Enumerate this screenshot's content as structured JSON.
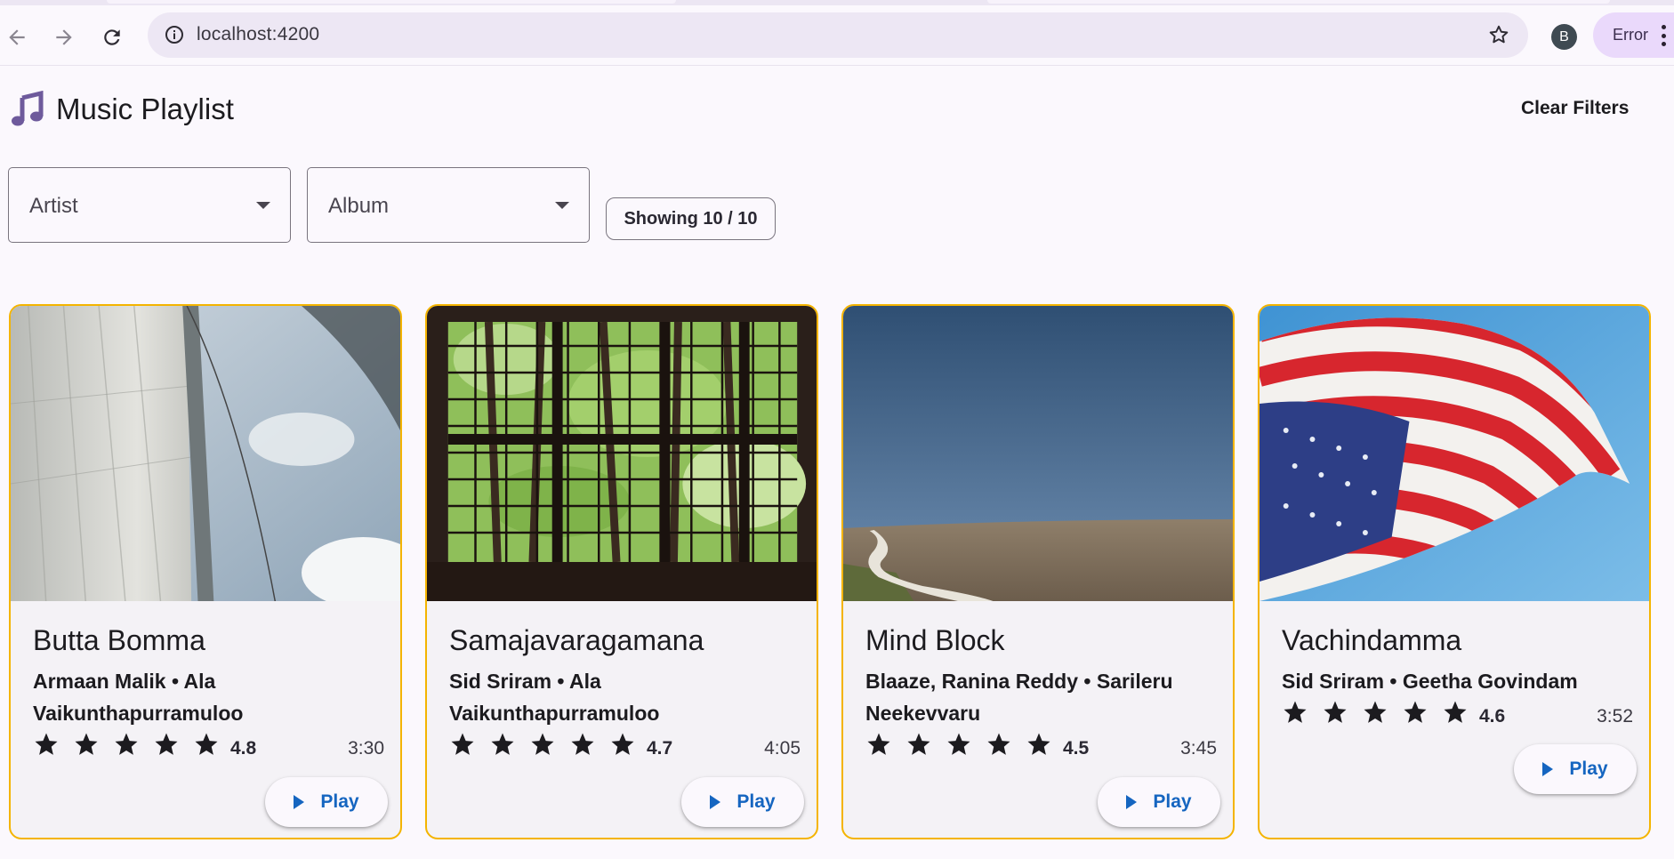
{
  "browser": {
    "url": "localhost:4200",
    "profile_initial": "B",
    "error_label": "Error"
  },
  "app": {
    "title": "Music Playlist",
    "clear_filters_label": "Clear Filters",
    "filters": {
      "artist_placeholder": "Artist",
      "album_placeholder": "Album",
      "count_label": "Showing 10 / 10"
    },
    "accent_color": "#f4b400",
    "link_color": "#1565c0"
  },
  "cards": [
    {
      "title": "Butta Bomma",
      "meta": "Armaan Malik • Ala Vaikunthapurramuloo",
      "rating": "4.8",
      "rating_stars": 5,
      "duration": "3:30",
      "play_label": "Play",
      "art": "sailboat-sails"
    },
    {
      "title": "Samajavaragamana",
      "meta": "Sid Sriram • Ala Vaikunthapurramuloo",
      "rating": "4.7",
      "rating_stars": 5,
      "duration": "4:05",
      "play_label": "Play",
      "art": "window-trees"
    },
    {
      "title": "Mind Block",
      "meta": "Blaaze, Ranina Reddy • Sarileru Neekevvaru",
      "rating": "4.5",
      "rating_stars": 5,
      "duration": "3:45",
      "play_label": "Play",
      "art": "field-road"
    },
    {
      "title": "Vachindamma",
      "meta": "Sid Sriram • Geetha Govindam",
      "rating": "4.6",
      "rating_stars": 5,
      "duration": "3:52",
      "play_label": "Play",
      "art": "waving-flag"
    }
  ]
}
